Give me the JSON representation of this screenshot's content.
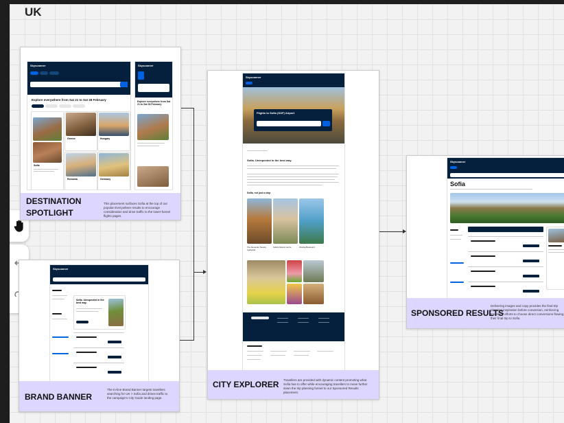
{
  "board": {
    "title": "UK"
  },
  "toolbar": {
    "icons": [
      "hand-icon",
      "undo-icon",
      "redo-icon"
    ]
  },
  "frames": {
    "destination_spotlight": {
      "title_line1": "DESTINATION",
      "title_line2": "SPOTLIGHT",
      "description": "This placement surfaces Sofia at the top of our popular Everywhere results to encourage consideration and drive traffic to the lower-funnel flights pages.",
      "page_heading": "Explore everywhere from Sat 21 to Sat 28 February",
      "mobile_heading": "Explore everywhere from Sat 21 to Sat 28 February",
      "cards": [
        "Sofia",
        "Greece",
        "Hungary",
        "Romania",
        "Germany"
      ]
    },
    "brand_banner": {
      "title": "BRAND BANNER",
      "description": "The In-line Brand Banner targets travellers searching for UK > Sofia and drives traffic to the campaign's City Guide landing page.",
      "banner_heading": "Sofia. Unexpected in the best way."
    },
    "city_explorer": {
      "title": "CITY EXPLORER",
      "description": "Travellers are provided with dynamic content promoting what Sofia has to offer while encouraging travellers to move further down the trip planning funnel to our Sponsored Results placement.",
      "hero_title": "Flights to Sofia (SOF) Airport",
      "headline": "Sofia. Unexpected in the best way.",
      "sub_headline": "Sofia, not just a stop",
      "tiles": [
        "The Alexander Nevsky Cathedral",
        "Sofia's historic centre",
        "Vitosha Boulevard"
      ]
    },
    "sponsored_results": {
      "title": "SPONSORED RESULTS",
      "description": "Delivering images and copy provides the final trip planning inspiration before conversion, reinforcing travellers' efforts to choose direct conversions flowing to their final trip to Sofia.",
      "page_title": "Sofia"
    }
  }
}
